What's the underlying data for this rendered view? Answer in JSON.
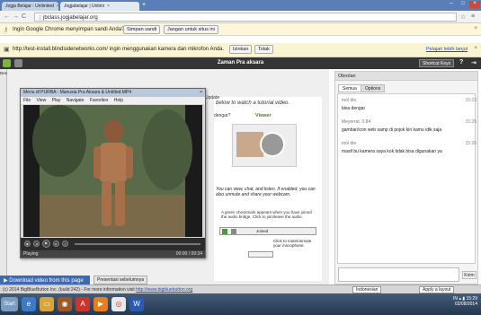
{
  "browser": {
    "tabs": [
      {
        "label": "Jogja Belajar : Unlimited"
      },
      {
        "label": "Jogjabelajar | Unlimi"
      }
    ],
    "url": "jbclass.jogjabelajar.org",
    "new_tab_glyph": "+"
  },
  "password_bar": {
    "message": "Ingin Google Chrome menyimpan sandi Anda?",
    "save_label": "Simpan sandi",
    "never_label": "Jangan untuk situs ini"
  },
  "media_bar": {
    "message": "http://test-install.blindsidenetworks.com/ ingin menggunakan kamera dan mikrofon Anda.",
    "allow_label": "Izinkan",
    "deny_label": "Tolak",
    "learn_more": "Pelajari lebih lanjut"
  },
  "app": {
    "title": "Zaman Pra aksara",
    "shortcut_label": "Shortcut Keys",
    "help_label": "?"
  },
  "desktop_panel": {
    "label": "Desktop"
  },
  "player": {
    "title": "Menu dl PURBA - Manusia Pra Aksara & Untitled.MP4",
    "menu": [
      "File",
      "View",
      "Play",
      "Navigate",
      "Favorites",
      "Help"
    ],
    "status": "Playing",
    "time": "00:00 / 09:34"
  },
  "tutorial": {
    "heading": "below to watch a tutorial video.",
    "viewer_label": "Viewer",
    "desc": "You can view, chat, and listen. If enabled, you can also unmute and share your webcam.",
    "audio_note": "A green checkmark appears when you have joined the audio bridge. Click to join/leave the audio.",
    "mute_note": "Click to mute/unmute your microphone.",
    "control_label": "Joined",
    "side_fragments": [
      "Update",
      "dengar?"
    ]
  },
  "chat": {
    "header": "Obrolan",
    "tabs": [
      "Semua",
      "Options"
    ],
    "messages": [
      {
        "name": "mol die",
        "time": "15:23",
        "text": "bisa dengar"
      },
      {
        "name": "Meyerrat, 0.84",
        "time": "15:25",
        "text": "gambar/icon web samp di pojok kiri kamu idik saja"
      },
      {
        "name": "mol die",
        "time": "15:26",
        "text": "masif bu kamera saya kok tidak bisa digunakan ya"
      }
    ],
    "send_label": "Kirim",
    "recipient": "Indonesian",
    "layout_select": "Apply a layout"
  },
  "footer": {
    "download_label": "Download video from this page",
    "copyright": "(c) 2014 BigBlueButton Inc. (build 242) - For more information visit",
    "copyright_link": "http://www.bigbluebutton.org",
    "presentation_tab": "Presentasi sebelumnya"
  },
  "taskbar": {
    "start_label": "Start",
    "lang": "IN",
    "time": "15:29",
    "date": "02/08/2014"
  },
  "colors": {
    "chrome_blue": "#5a7fb8",
    "app_header": "#353535",
    "taskbar": "#2f4560"
  }
}
